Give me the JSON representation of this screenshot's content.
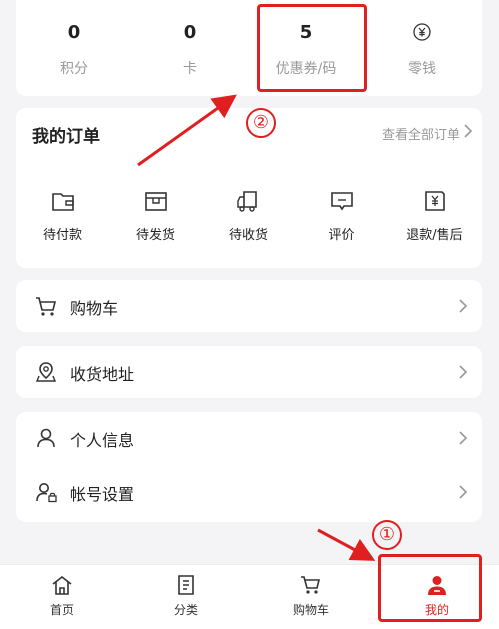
{
  "stats": [
    {
      "value": "0",
      "label": "积分"
    },
    {
      "value": "0",
      "label": "卡"
    },
    {
      "value": "5",
      "label": "优惠券/码"
    },
    {
      "value": "",
      "label": "零钱",
      "icon": "coin-icon"
    }
  ],
  "orders": {
    "title": "我的订单",
    "view_all": "查看全部订单",
    "items": [
      {
        "label": "待付款",
        "icon": "wallet-icon"
      },
      {
        "label": "待发货",
        "icon": "box-icon"
      },
      {
        "label": "待收货",
        "icon": "truck-icon"
      },
      {
        "label": "评价",
        "icon": "comment-icon"
      },
      {
        "label": "退款/售后",
        "icon": "refund-icon"
      }
    ]
  },
  "menu": {
    "cart": "购物车",
    "address": "收货地址",
    "profile": "个人信息",
    "account": "帐号设置"
  },
  "tabbar": {
    "items": [
      {
        "label": "首页",
        "icon": "home-icon"
      },
      {
        "label": "分类",
        "icon": "category-icon"
      },
      {
        "label": "购物车",
        "icon": "cart-icon"
      },
      {
        "label": "我的",
        "icon": "user-icon"
      }
    ],
    "active_color": "#e02020"
  },
  "annotations": {
    "mark1": "①",
    "mark2": "②",
    "color": "#e02020"
  }
}
